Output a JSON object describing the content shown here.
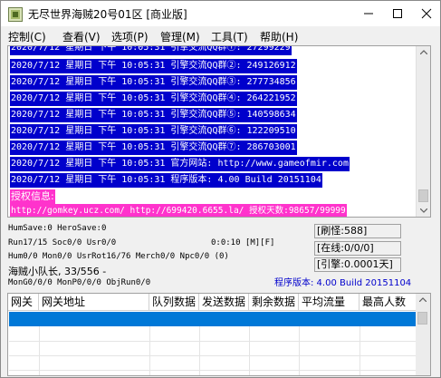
{
  "window": {
    "title": "无尽世界海贼20号01区 [商业版]"
  },
  "menu": [
    {
      "label": "控制(C)"
    },
    {
      "label": "查看(V)"
    },
    {
      "label": "选项(P)"
    },
    {
      "label": "管理(M)"
    },
    {
      "label": "工具(T)"
    },
    {
      "label": "帮助(H)"
    }
  ],
  "log": {
    "lines": [
      "2020/7/12 星期日 下午 10:05:31 引擎交流QQ群①: 27299229",
      "2020/7/12 星期日 下午 10:05:31 引擎交流QQ群②: 249126912",
      "2020/7/12 星期日 下午 10:05:31 引擎交流QQ群③: 277734856",
      "2020/7/12 星期日 下午 10:05:31 引擎交流QQ群④: 264221952",
      "2020/7/12 星期日 下午 10:05:31 引擎交流QQ群⑤: 140598634",
      "2020/7/12 星期日 下午 10:05:31 引擎交流QQ群⑥: 122209510",
      "2020/7/12 星期日 下午 10:05:31 引擎交流QQ群⑦: 286703001",
      "2020/7/12 星期日 下午 10:05:31 官方网站: http://www.gameofmir.com",
      "2020/7/12 星期日 下午 10:05:31 程序版本: 4.00 Build 20151104"
    ],
    "auth_title": "授权信息:",
    "auth_line": "http://gomkey.ucz.com/ http://699420.6655.la/ 授权天数:98657/99999"
  },
  "status": {
    "line1": "HumSave:0 HeroSave:0",
    "line2": "Run17/15 Soc0/0 Usr0/0",
    "timer": "0:0:10 [M][F]",
    "line3": "Hum0/0 Mon0/0 UsrRot16/76 Merch0/0 Npc0/0 (0)",
    "line4": "海贼小队长, 33/556 -",
    "line5": "MonG0/0/0 MonP0/0/0 ObjRun0/0",
    "refresh": "[刷怪:588]",
    "online": "[在线:0/0/0]",
    "engine": "[引擎:0.0001天]",
    "version": "程序版本: 4.00 Build 20151104"
  },
  "gateway": {
    "columns": [
      "网关",
      "网关地址",
      "队列数据",
      "发送数据",
      "剩余数据",
      "平均流量",
      "最高人数"
    ]
  },
  "colors": {
    "log_selection": "#0000cc",
    "auth_highlight": "#ff33cc",
    "version_text": "#0000cc",
    "row_selection": "#0078d7"
  }
}
